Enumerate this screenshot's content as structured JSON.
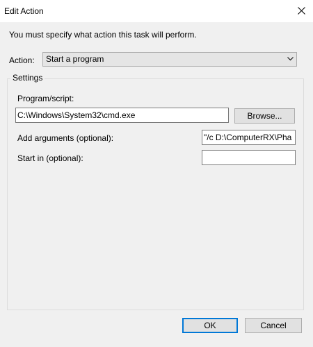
{
  "window": {
    "title": "Edit Action",
    "close_icon": "close-icon"
  },
  "dialog": {
    "instruction": "You must specify what action this task will perform.",
    "action": {
      "label": "Action:",
      "selected": "Start a program",
      "dropdown_icon": "chevron-down-icon"
    },
    "settings": {
      "legend": "Settings",
      "program_label": "Program/script:",
      "program_value": "C:\\Windows\\System32\\cmd.exe",
      "browse_label": "Browse...",
      "arguments_label": "Add arguments (optional):",
      "arguments_value": "\"/c D:\\ComputerRX\\Pha",
      "start_in_label": "Start in (optional):",
      "start_in_value": ""
    },
    "buttons": {
      "ok": "OK",
      "cancel": "Cancel"
    }
  },
  "colors": {
    "dialog_background": "#f0f0f0",
    "button_face": "#e1e1e1",
    "default_button_accent": "#0078d7",
    "input_border": "#7a7a7a"
  }
}
